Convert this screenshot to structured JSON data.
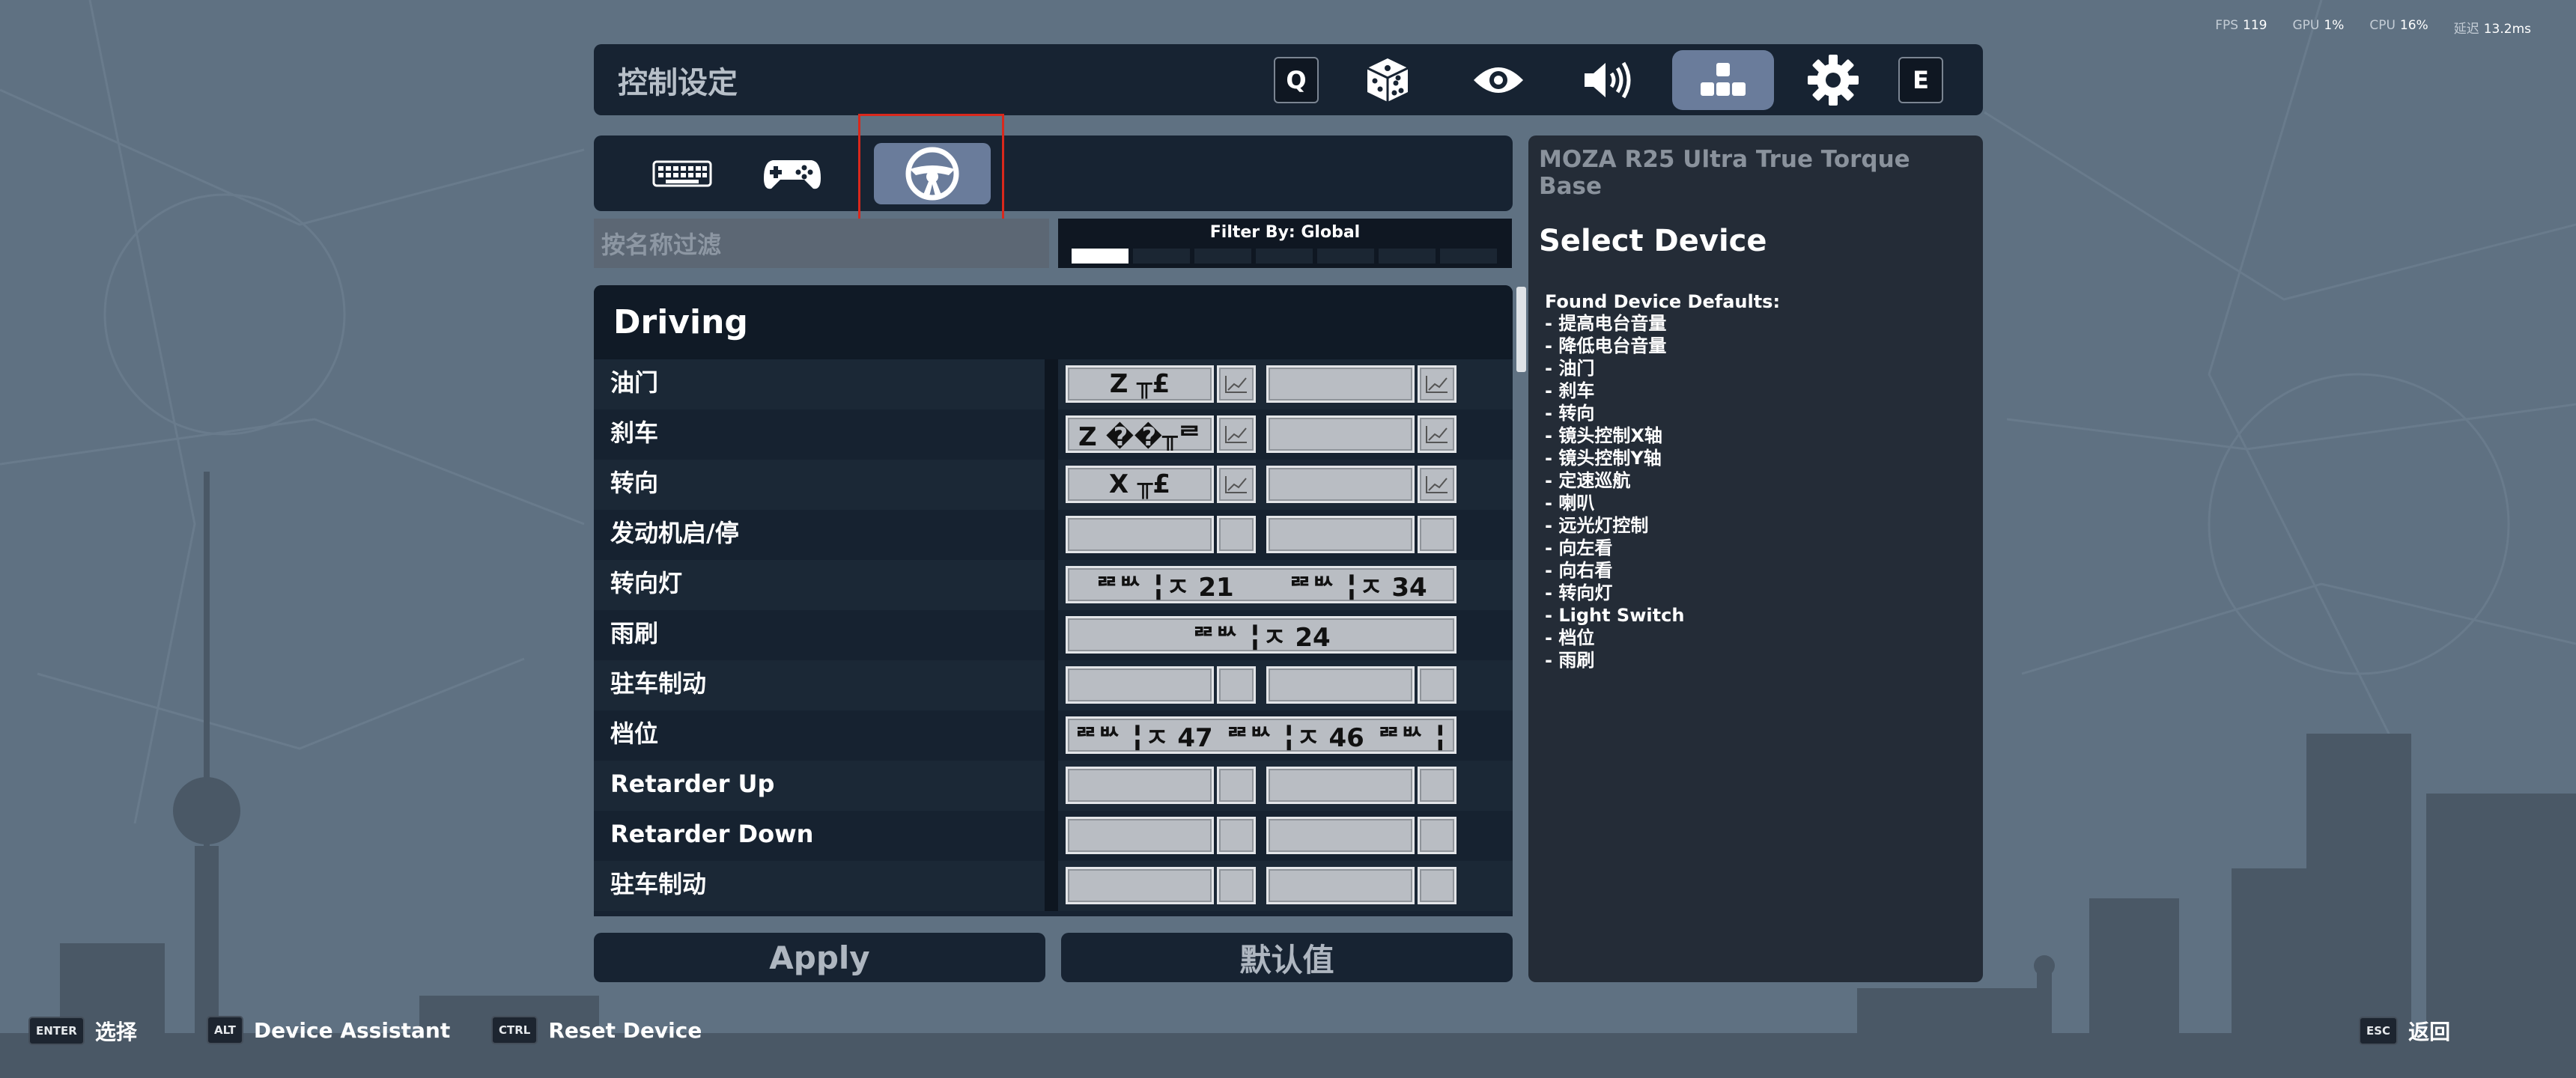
{
  "perf": {
    "fps_label": "FPS",
    "fps_value": "119",
    "gpu_label": "GPU",
    "gpu_value": "1%",
    "cpu_label": "CPU",
    "cpu_value": "16%",
    "latency_label": "延迟",
    "latency_value": "13.2ms"
  },
  "header": {
    "title": "控制设定",
    "icons": [
      "q-key-icon",
      "dice-icon",
      "eye-icon",
      "speaker-icon",
      "controls-icon",
      "gear-icon",
      "e-key-icon"
    ],
    "q_key": "Q",
    "e_key": "E",
    "active_icon": "controls-icon"
  },
  "tabs": {
    "items": [
      "keyboard-icon",
      "gamepad-icon",
      "steering-wheel-icon"
    ],
    "active": "steering-wheel-icon"
  },
  "search": {
    "placeholder": "按名称过滤"
  },
  "filter": {
    "label": "Filter By: Global",
    "segments": 7,
    "active_segment": 1
  },
  "list": {
    "section_title": "Driving",
    "rows": [
      {
        "label": "油门",
        "bind1": "Z ╥£",
        "bind2": ""
      },
      {
        "label": "刹车",
        "bind1": "Z ��╥ᄅ",
        "bind2": ""
      },
      {
        "label": "转向",
        "bind1": "X ╥£",
        "bind2": ""
      },
      {
        "label": "发动机启/停",
        "bind1": "",
        "bind2": ""
      },
      {
        "label": "转向灯",
        "wide": [
          "ᄙᄡ ╏ㅈ 21",
          "ᄙᄡ ╏ㅈ 34"
        ]
      },
      {
        "label": "雨刷",
        "wide": [
          "ᄙᄡ ╏ㅈ 24"
        ]
      },
      {
        "label": "驻车制动",
        "bind1": "",
        "bind2": ""
      },
      {
        "label": "档位",
        "wide": [
          "ᄙᄡ ╏ㅈ 47",
          "ᄙᄡ ╏ㅈ 46",
          "ᄙᄡ ╏"
        ]
      },
      {
        "label": "Retarder Up",
        "bind1": "",
        "bind2": ""
      },
      {
        "label": "Retarder Down",
        "bind1": "",
        "bind2": ""
      },
      {
        "label": "驻车制动",
        "bind1": "",
        "bind2": ""
      }
    ]
  },
  "buttons": {
    "apply": "Apply",
    "defaults": "默认值"
  },
  "panel": {
    "device": "MOZA R25 Ultra True Torque Base",
    "heading": "Select Device",
    "found_label": "Found  Device Defaults:",
    "items": [
      "- 提高电台音量",
      "- 降低电台音量",
      "- 油门",
      "- 刹车",
      "- 转向",
      "- 镜头控制X轴",
      "- 镜头控制Y轴",
      "- 定速巡航",
      "- 喇叭",
      "- 远光灯控制",
      "- 向左看",
      "- 向右看",
      "- 转向灯",
      "- Light Switch",
      "- 档位",
      "- 雨刷"
    ]
  },
  "footer": {
    "enter_key": "ENTER",
    "enter_label": "选择",
    "alt_key": "ALT",
    "alt_label": "Device Assistant",
    "ctrl_key": "CTRL",
    "ctrl_label": "Reset Device",
    "esc_key": "ESC",
    "esc_label": "返回"
  },
  "colors": {
    "panel_bg": "#172332",
    "active_tab": "#6a7c9b",
    "highlight": "#d9281c",
    "background": "#5f7182"
  }
}
